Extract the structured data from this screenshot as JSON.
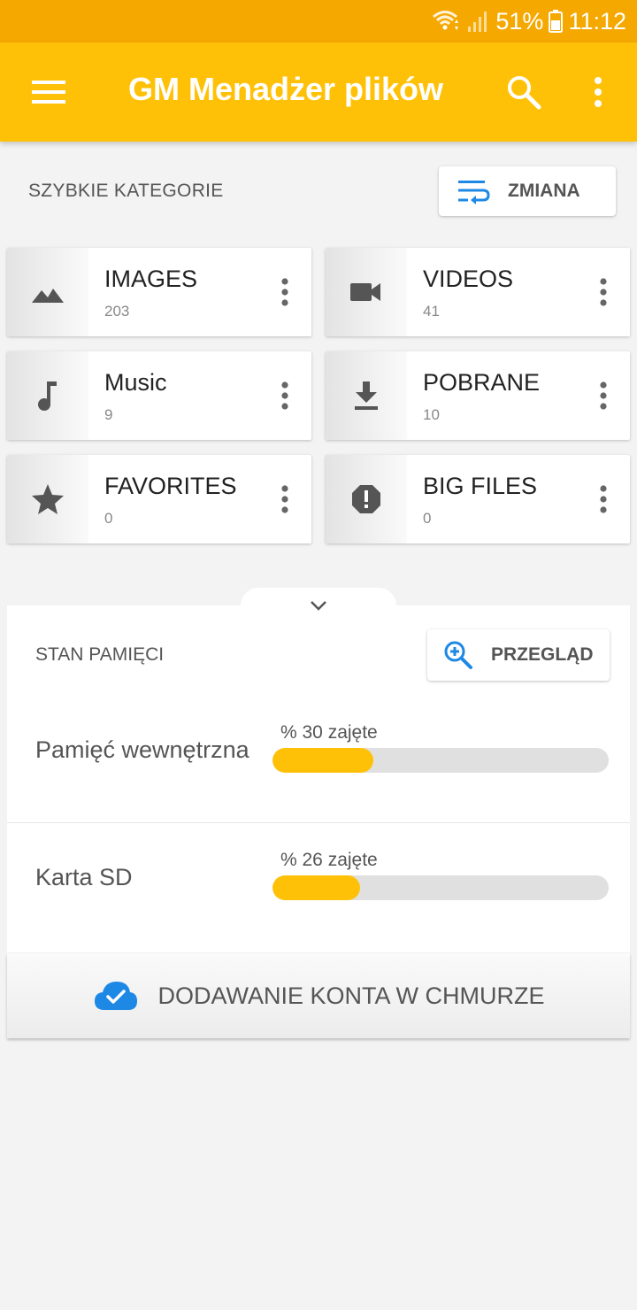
{
  "status_bar": {
    "battery": "51%",
    "time": "11:12",
    "icons": [
      "wifi-icon",
      "signal-icon",
      "battery-icon"
    ]
  },
  "app_bar": {
    "title": "GM Menadżer plików",
    "icons": [
      "menu-icon",
      "search-icon",
      "more-vert-icon"
    ]
  },
  "quick_categories": {
    "label": "SZYBKIE KATEGORIE",
    "change_button": "ZMIANA",
    "change_icon": "wrap-text-icon",
    "tiles": [
      {
        "name": "IMAGES",
        "count": "203",
        "icon": "landscape-icon"
      },
      {
        "name": "VIDEOS",
        "count": "41",
        "icon": "videocam-icon"
      },
      {
        "name": "Music",
        "count": "9",
        "icon": "music-note-icon"
      },
      {
        "name": "POBRANE",
        "count": "10",
        "icon": "download-icon"
      },
      {
        "name": "FAVORITES",
        "count": "0",
        "icon": "star-icon"
      },
      {
        "name": "BIG FILES",
        "count": "0",
        "icon": "error-icon"
      }
    ]
  },
  "storage": {
    "label": "STAN PAMIĘCI",
    "review_button": "PRZEGLĄD",
    "review_icon": "zoom-in-icon",
    "items": [
      {
        "name": "Pamięć wewnętrzna",
        "used_text": "% 30 zajęte",
        "used_percent": 30
      },
      {
        "name": "Karta SD",
        "used_text": "% 26 zajęte",
        "used_percent": 26
      }
    ]
  },
  "cloud": {
    "label": "DODAWANIE KONTA W CHMURZE",
    "icon": "cloud-done-icon"
  },
  "colors": {
    "status_bar": "#f5a800",
    "app_bar": "#ffc107",
    "accent_blue": "#1e88e5",
    "progress_fill": "#ffc107",
    "progress_track": "#e0e0e0",
    "background": "#f3f3f3"
  }
}
